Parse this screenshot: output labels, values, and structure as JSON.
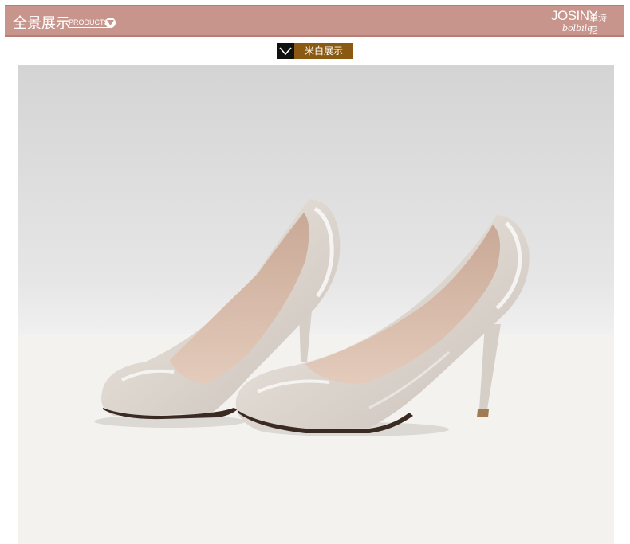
{
  "header": {
    "title": "全景展示",
    "subtitle": "PRODUCTS",
    "logo_main": "JOSINY",
    "logo_cn": "卓诗尼",
    "logo_script": "bolbile"
  },
  "color_tag": {
    "label": "米白展示"
  },
  "photo": {
    "subject": "beige-patent-pointed-pumps",
    "accent": "#8a5a12"
  }
}
